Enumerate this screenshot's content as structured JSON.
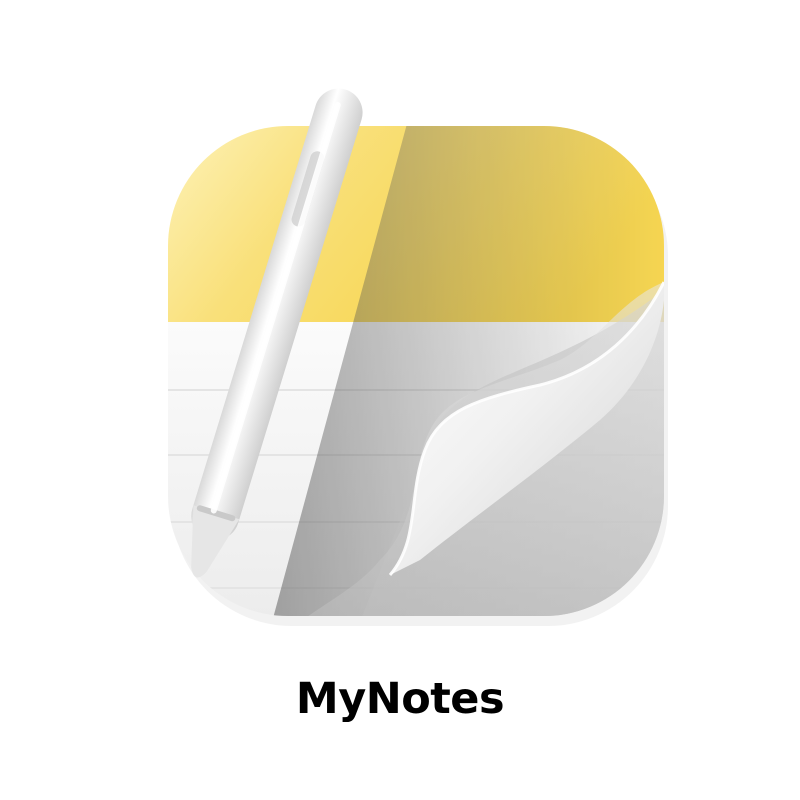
{
  "app": {
    "name": "MyNotes",
    "icon": "notes-pad-with-pencil-icon"
  },
  "colors": {
    "header_yellow": "#f7d64a",
    "header_light": "#fdf0b0",
    "paper": "#f6f6f6",
    "paper_shadow": "#b9b9b9",
    "rule_line": "#e6e6e6",
    "text": "#000000"
  }
}
